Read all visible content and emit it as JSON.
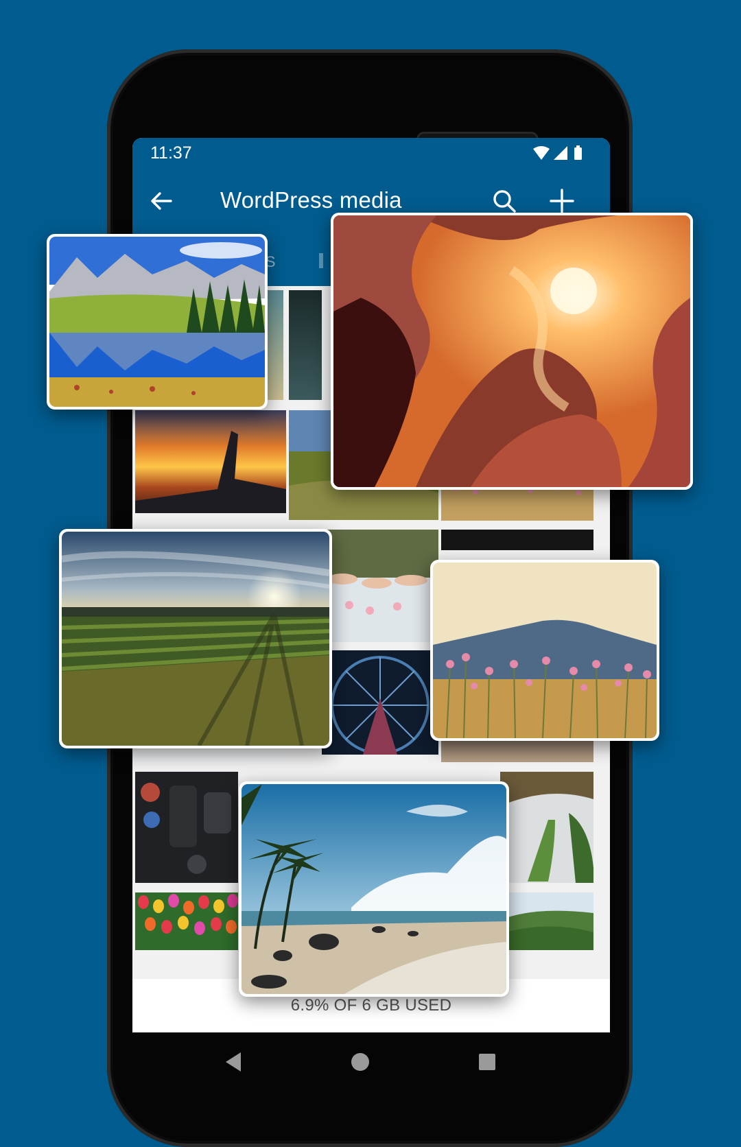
{
  "status": {
    "time": "11:37"
  },
  "appbar": {
    "title": "WordPress media",
    "back_icon": "arrow-back-icon",
    "search_icon": "search-icon",
    "add_icon": "plus-icon"
  },
  "tabs": [
    {
      "label": "GES"
    }
  ],
  "storage": {
    "label": "6.9% OF 6 GB USED"
  },
  "nav": {
    "back": "nav-back-icon",
    "home": "nav-home-icon",
    "recents": "nav-recents-icon"
  },
  "colors": {
    "background": "#005c8f",
    "appbar": "#005c8f",
    "screen": "#ffffff"
  },
  "photos": [
    "mountain-lake-photo",
    "slot-canyon-photo",
    "vineyard-sunset-photo",
    "pink-flowers-mountain-photo",
    "tropical-beach-photo",
    "airplane-wing-sunset-photo",
    "field-photo",
    "pink-flowers-photo",
    "dessert-table-photo",
    "ferris-wheel-photo",
    "dark-photo",
    "table-flowers-photo",
    "car-photo",
    "camera-gear-photo",
    "garden-path-photo",
    "tulips-photo",
    "green-hills-photo"
  ]
}
